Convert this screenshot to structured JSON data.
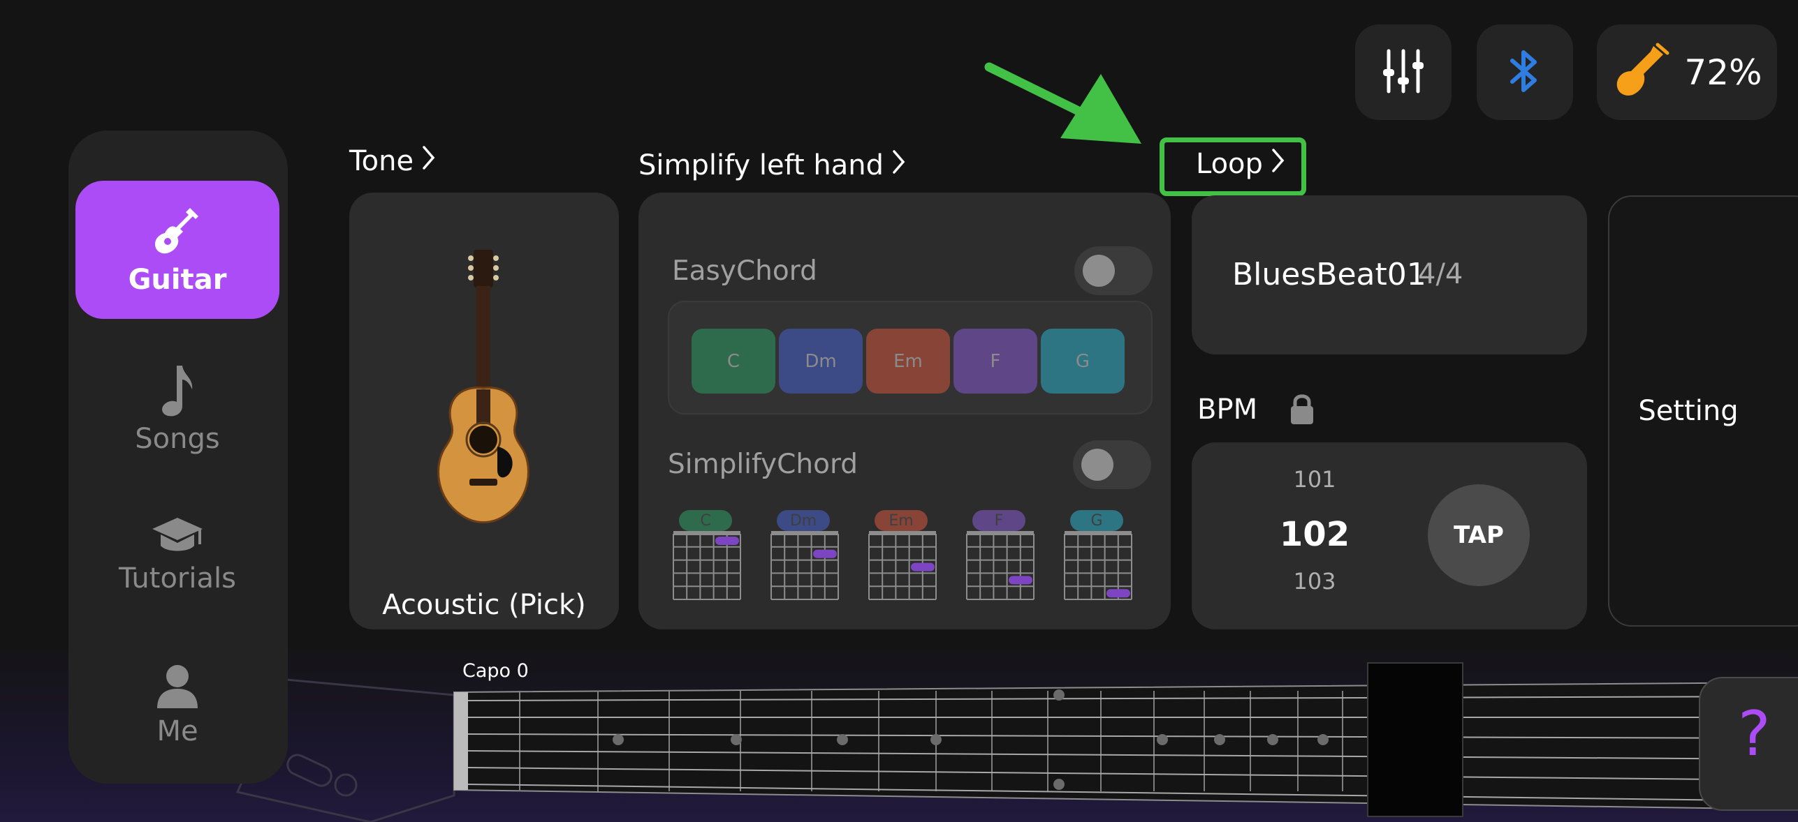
{
  "sidebar": {
    "items": [
      {
        "label": "Guitar",
        "icon": "electric-guitar-icon",
        "active": true
      },
      {
        "label": "Songs",
        "icon": "music-note-icon",
        "active": false
      },
      {
        "label": "Tutorials",
        "icon": "graduation-cap-icon",
        "active": false
      },
      {
        "label": "Me",
        "icon": "person-icon",
        "active": false
      }
    ]
  },
  "top_bar": {
    "mixer_icon": "sliders-icon",
    "bluetooth_icon": "bluetooth-icon",
    "battery_icon": "guitar-battery-icon",
    "battery_level": "72%",
    "battery_fraction": 0.72
  },
  "tone": {
    "header": "Tone",
    "instrument_name": "Acoustic (Pick)"
  },
  "simplify": {
    "header": "Simplify left hand",
    "easy_chord_label": "EasyChord",
    "easy_chord_on": false,
    "simplify_chord_label": "SimplifyChord",
    "simplify_chord_on": false,
    "chords": [
      {
        "name": "C",
        "color": "#2e6b4c"
      },
      {
        "name": "Dm",
        "color": "#3c4a86"
      },
      {
        "name": "Em",
        "color": "#874437"
      },
      {
        "name": "F",
        "color": "#5e4687"
      },
      {
        "name": "G",
        "color": "#2d7582"
      }
    ]
  },
  "loop": {
    "header": "Loop",
    "name": "BluesBeat01",
    "time_signature": "4/4"
  },
  "bpm": {
    "label": "BPM",
    "lock_icon": "lock-icon",
    "prev": "101",
    "current": "102",
    "next": "103",
    "tap_label": "TAP"
  },
  "setting": {
    "label": "Setting"
  },
  "fretboard": {
    "capo_label": "Capo 0"
  },
  "help": {
    "symbol": "?"
  },
  "colors": {
    "accent": "#ac4cf7",
    "highlight": "#43c046",
    "bluetooth": "#2f7de1",
    "battery_icon": "#f6a01a"
  }
}
